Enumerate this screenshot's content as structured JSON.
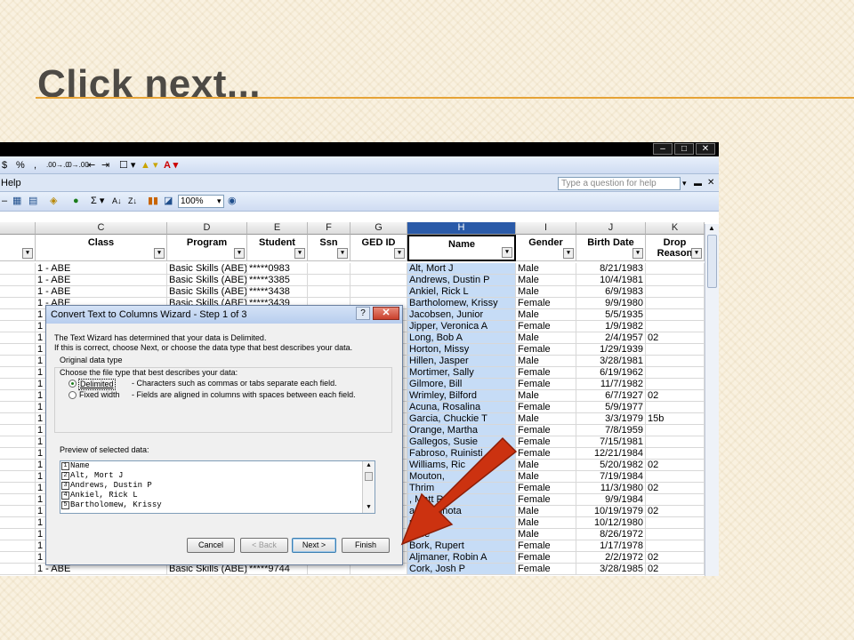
{
  "slide": {
    "title": "Click next..."
  },
  "excel": {
    "window_buttons": [
      "–",
      "□",
      "✕"
    ],
    "toolbar1": [
      "$",
      "%",
      ",",
      ".00→.0",
      ".0→.00",
      "⇤",
      "⇥",
      "☐ ▾",
      "▲ ▾",
      "A ▾"
    ],
    "menu_help": "Help",
    "help_placeholder": "Type a question for help",
    "zoom": "100%",
    "columns": [
      {
        "letter": "C",
        "field": "Class"
      },
      {
        "letter": "D",
        "field": "Program"
      },
      {
        "letter": "E",
        "field": "Student"
      },
      {
        "letter": "F",
        "field": "Ssn"
      },
      {
        "letter": "G",
        "field": "GED ID"
      },
      {
        "letter": "H",
        "field": "Name"
      },
      {
        "letter": "I",
        "field": "Gender"
      },
      {
        "letter": "J",
        "field": "Birth Date"
      },
      {
        "letter": "K",
        "field": "Drop Reason"
      }
    ],
    "rows": [
      {
        "c": "1 - ABE",
        "d": "Basic Skills (ABE)",
        "e": "*****0983",
        "h": "Alt, Mort J",
        "i": "Male",
        "j": "8/21/1983",
        "k": ""
      },
      {
        "c": "1 - ABE",
        "d": "Basic Skills (ABE)",
        "e": "*****3385",
        "h": "Andrews, Dustin P",
        "i": "Male",
        "j": "10/4/1981",
        "k": ""
      },
      {
        "c": "1 - ABE",
        "d": "Basic Skills (ABE)",
        "e": "*****3438",
        "h": "Ankiel, Rick L",
        "i": "Male",
        "j": "6/9/1983",
        "k": ""
      },
      {
        "c": "1 - ABE",
        "d": "Basic Skills (ABE)",
        "e": "*****3439",
        "h": "Bartholomew, Krissy",
        "i": "Female",
        "j": "9/9/1980",
        "k": ""
      },
      {
        "c": "1",
        "d": "",
        "e": "",
        "h": "Jacobsen, Junior",
        "i": "Male",
        "j": "5/5/1935",
        "k": ""
      },
      {
        "c": "1",
        "d": "",
        "e": "",
        "h": "Jipper, Veronica A",
        "i": "Female",
        "j": "1/9/1982",
        "k": ""
      },
      {
        "c": "1",
        "d": "",
        "e": "",
        "h": "Long, Bob A",
        "i": "Male",
        "j": "2/4/1957",
        "k": "02"
      },
      {
        "c": "1",
        "d": "",
        "e": "",
        "h": "Horton, Missy",
        "i": "Female",
        "j": "1/29/1939",
        "k": ""
      },
      {
        "c": "1",
        "d": "",
        "e": "",
        "h": "Hillen, Jasper",
        "i": "Male",
        "j": "3/28/1981",
        "k": ""
      },
      {
        "c": "1",
        "d": "",
        "e": "",
        "h": "Mortimer, Sally",
        "i": "Female",
        "j": "6/19/1962",
        "k": ""
      },
      {
        "c": "1",
        "d": "",
        "e": "",
        "h": "Gilmore, Bill",
        "i": "Female",
        "j": "11/7/1982",
        "k": ""
      },
      {
        "c": "1",
        "d": "",
        "e": "",
        "h": "Wrimley, Bilford",
        "i": "Male",
        "j": "6/7/1927",
        "k": "02"
      },
      {
        "c": "1",
        "d": "",
        "e": "",
        "h": "Acuna, Rosalina",
        "i": "Female",
        "j": "5/9/1977",
        "k": ""
      },
      {
        "c": "1",
        "d": "",
        "e": "",
        "h": "Garcia, Chuckie T",
        "i": "Male",
        "j": "3/3/1979",
        "k": "15b"
      },
      {
        "c": "1",
        "d": "",
        "e": "",
        "h": "Orange, Martha",
        "i": "Female",
        "j": "7/8/1959",
        "k": ""
      },
      {
        "c": "1",
        "d": "",
        "e": "",
        "h": "Gallegos, Susie",
        "i": "Female",
        "j": "7/15/1981",
        "k": ""
      },
      {
        "c": "1",
        "d": "",
        "e": "",
        "h": "Fabroso, Ruinisti",
        "i": "Female",
        "j": "12/21/1984",
        "k": ""
      },
      {
        "c": "1",
        "d": "",
        "e": "",
        "h": "Williams, Ric",
        "i": "Male",
        "j": "5/20/1982",
        "k": "02"
      },
      {
        "c": "1",
        "d": "",
        "e": "",
        "h": "Mouton,",
        "i": "Male",
        "j": "7/19/1984",
        "k": ""
      },
      {
        "c": "1",
        "d": "",
        "e": "",
        "h": "Thrim",
        "i": "Female",
        "j": "11/3/1980",
        "k": "02"
      },
      {
        "c": "1",
        "d": "",
        "e": "",
        "h": ", Matt R",
        "i": "Female",
        "j": "9/9/1984",
        "k": ""
      },
      {
        "c": "1",
        "d": "",
        "e": "",
        "h": "ant, Amnota",
        "i": "Male",
        "j": "10/19/1979",
        "k": "02"
      },
      {
        "c": "1",
        "d": "",
        "e": "",
        "h": "mmie Z",
        "i": "Male",
        "j": "10/12/1980",
        "k": ""
      },
      {
        "c": "1",
        "d": "",
        "e": "",
        "h": "Jose",
        "i": "Male",
        "j": "8/26/1972",
        "k": ""
      },
      {
        "c": "1",
        "d": "",
        "e": "",
        "h": "Bork, Rupert",
        "i": "Female",
        "j": "1/17/1978",
        "k": ""
      },
      {
        "c": "1",
        "d": "",
        "e": "",
        "h": "Aljmaner, Robin A",
        "i": "Female",
        "j": "2/2/1972",
        "k": "02"
      },
      {
        "c": "1 - ABE",
        "d": "Basic Skills (ABE)",
        "e": "*****9744",
        "h": "Cork, Josh P",
        "i": "Female",
        "j": "3/28/1985",
        "k": "02"
      }
    ]
  },
  "dialog": {
    "title": "Convert Text to Columns Wizard - Step 1 of 3",
    "help": "?",
    "close": "✕",
    "intro1": "The Text Wizard has determined that your data is Delimited.",
    "intro2": "If this is correct, choose Next, or choose the data type that best describes your data.",
    "group_label": "Original data type",
    "choose_label": "Choose the file type that best describes your data:",
    "opt1": "Delimited",
    "opt1_desc": "- Characters such as commas or tabs separate each field.",
    "opt2": "Fixed width",
    "opt2_desc": "- Fields are aligned in columns with spaces between each field.",
    "preview_label": "Preview of selected data:",
    "preview_lines": [
      {
        "n": "1",
        "t": "Name"
      },
      {
        "n": "2",
        "t": "Alt, Mort J"
      },
      {
        "n": "3",
        "t": "Andrews, Dustin P"
      },
      {
        "n": "4",
        "t": "Ankiel, Rick L"
      },
      {
        "n": "5",
        "t": "Bartholomew, Krissy"
      }
    ],
    "buttons": {
      "cancel": "Cancel",
      "back": "< Back",
      "next": "Next >",
      "finish": "Finish"
    }
  }
}
